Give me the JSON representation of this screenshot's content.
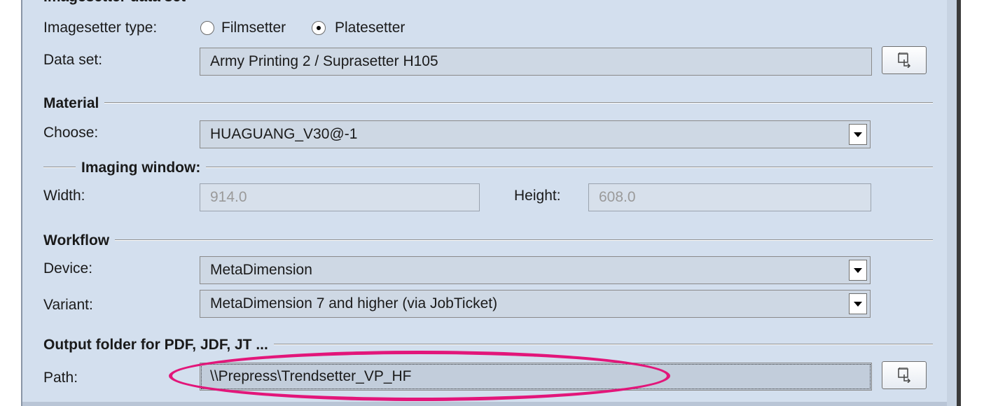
{
  "header_partial": "Imagesetter data set",
  "imagesetter_type": {
    "label": "Imagesetter type:",
    "options": [
      {
        "label": "Filmsetter",
        "selected": false
      },
      {
        "label": "Platesetter",
        "selected": true
      }
    ]
  },
  "data_set": {
    "label": "Data set:",
    "value": "Army Printing 2 / Suprasetter H105",
    "browse_icon": "folder-browse-icon"
  },
  "material": {
    "title": "Material",
    "choose_label": "Choose:",
    "choose_value": "HUAGUANG_V30@-1"
  },
  "imaging_window": {
    "title": "Imaging window:",
    "width_label": "Width:",
    "width_value": "914.0",
    "height_label": "Height:",
    "height_value": "608.0"
  },
  "workflow": {
    "title": "Workflow",
    "device_label": "Device:",
    "device_value": "MetaDimension",
    "variant_label": "Variant:",
    "variant_value": "MetaDimension 7 and higher (via JobTicket)"
  },
  "output": {
    "title": "Output folder for PDF, JDF, JT ...",
    "path_label": "Path:",
    "path_value": "\\\\Prepress\\Trendsetter_VP_HF",
    "browse_icon": "folder-browse-icon"
  },
  "colors": {
    "panel": "#d3dfee",
    "highlight": "#e2167a"
  }
}
